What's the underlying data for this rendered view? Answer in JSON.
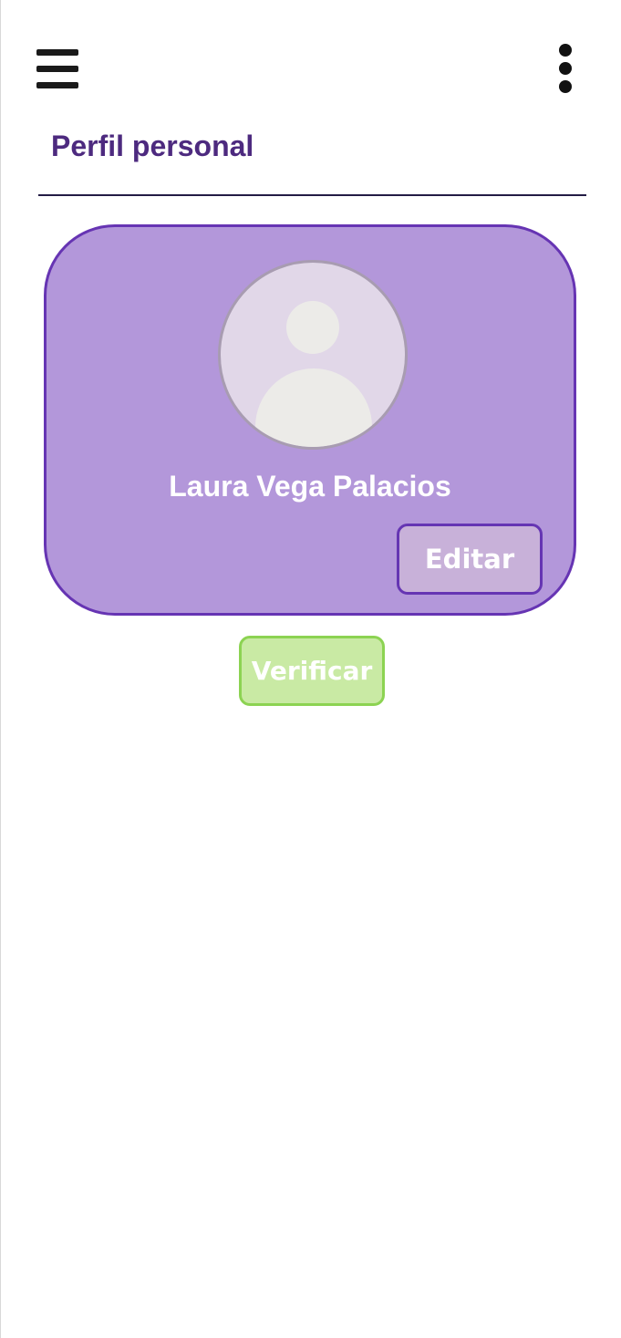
{
  "header": {
    "menu_icon": "hamburger-menu-icon",
    "more_icon": "more-vertical-icon",
    "title": "Perfil personal"
  },
  "profile": {
    "avatar_icon": "default-user-avatar-icon",
    "name": "Laura Vega Palacios",
    "edit_label": "Editar"
  },
  "actions": {
    "verify_label": "Verificar"
  },
  "colors": {
    "title": "#4d2a7f",
    "card_background": "#b397da",
    "card_border": "#6634b3",
    "edit_button_background": "#c8b1d9",
    "verify_button_background": "#c9eaa4",
    "verify_button_border": "#8cd352"
  }
}
